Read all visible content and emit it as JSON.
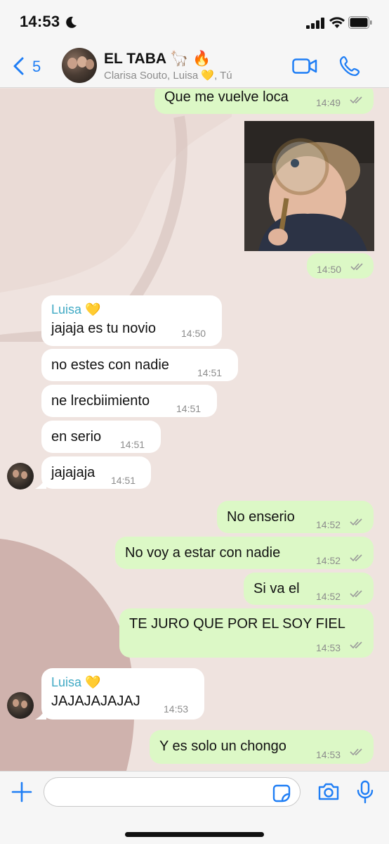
{
  "status_bar": {
    "time": "14:53"
  },
  "header": {
    "back_count": "5",
    "group_name": "EL TABA 🦙 🔥",
    "members": "Clarisa Souto, Luisa 💛, Tú"
  },
  "messages": [
    {
      "direction": "out",
      "text": "Que me vuelve loca",
      "time": "14:49"
    },
    {
      "direction": "out",
      "type": "image",
      "time": "14:50"
    },
    {
      "direction": "in",
      "sender": "Luisa 💛",
      "text": "jajaja es tu novio",
      "time": "14:50"
    },
    {
      "direction": "in",
      "text": "no estes con nadie",
      "time": "14:51"
    },
    {
      "direction": "in",
      "text": "ne lrecbiimiento",
      "time": "14:51"
    },
    {
      "direction": "in",
      "text": "en serio",
      "time": "14:51"
    },
    {
      "direction": "in",
      "text": "jajajaja",
      "time": "14:51"
    },
    {
      "direction": "out",
      "text": "No enserio",
      "time": "14:52"
    },
    {
      "direction": "out",
      "text": "No voy a estar con nadie",
      "time": "14:52"
    },
    {
      "direction": "out",
      "text": "Si va el",
      "time": "14:52"
    },
    {
      "direction": "out",
      "text": "TE JURO QUE POR EL SOY FIEL",
      "time": "14:53"
    },
    {
      "direction": "in",
      "sender": "Luisa 💛",
      "text": "JAJAJAJAJAJ",
      "time": "14:53"
    },
    {
      "direction": "out",
      "text": "Y es solo un chongo",
      "time": "14:53"
    }
  ],
  "composer": {
    "value": ""
  },
  "colors": {
    "outgoing_bubble": "#dcf8c6",
    "incoming_bubble": "#ffffff",
    "accent_blue": "#1f7ef5",
    "sender_name": "#3fa9c4",
    "chat_background": "#efe3df"
  },
  "icons": [
    "moon-icon",
    "signal-icon",
    "wifi-icon",
    "battery-icon",
    "back-chevron-icon",
    "video-call-icon",
    "phone-call-icon",
    "double-check-icon",
    "plus-icon",
    "sticker-icon",
    "camera-icon",
    "microphone-icon"
  ]
}
